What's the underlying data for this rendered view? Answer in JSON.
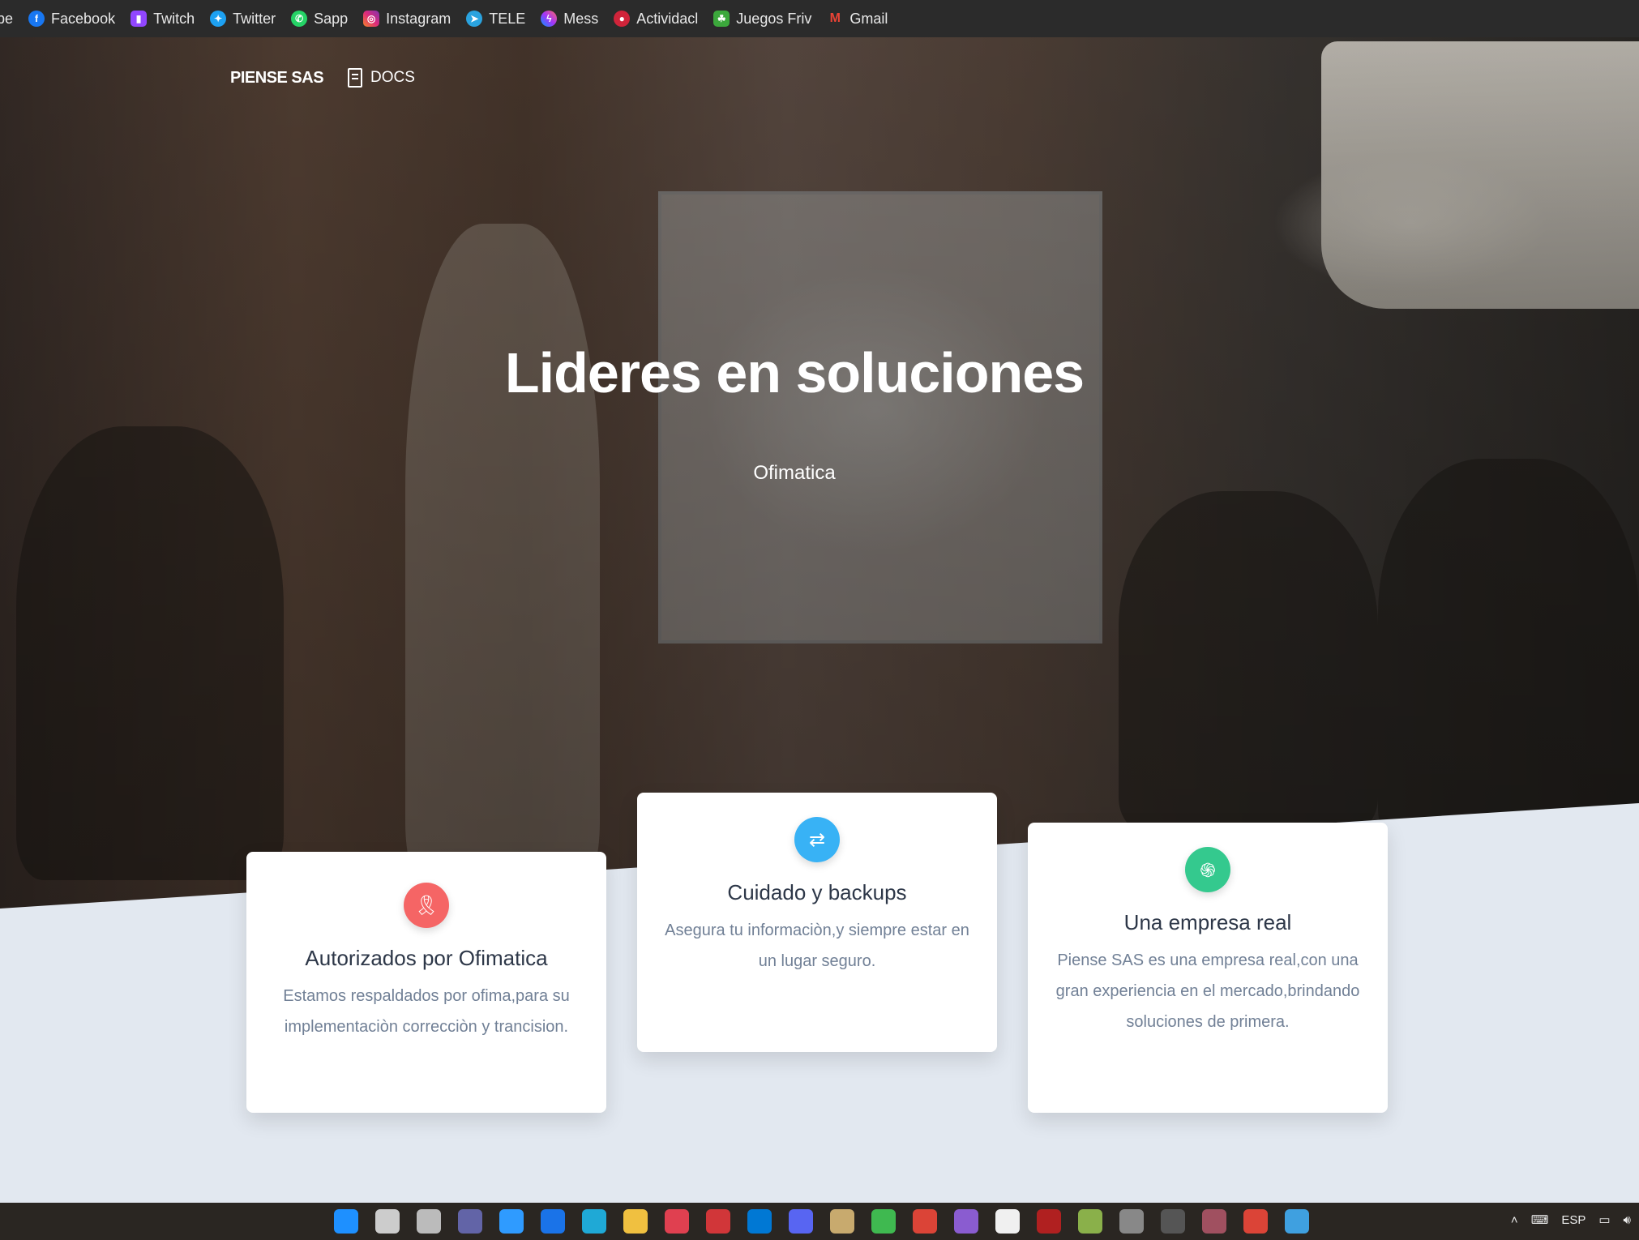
{
  "bookmarks": [
    {
      "label": "be",
      "icon": "youtube-icon",
      "color": "#ff0000"
    },
    {
      "label": "Facebook",
      "icon": "facebook-icon",
      "color": "#1877f2"
    },
    {
      "label": "Twitch",
      "icon": "twitch-icon",
      "color": "#9146ff"
    },
    {
      "label": "Twitter",
      "icon": "twitter-icon",
      "color": "#1da1f2"
    },
    {
      "label": "Sapp",
      "icon": "whatsapp-icon",
      "color": "#25d366"
    },
    {
      "label": "Instagram",
      "icon": "instagram-icon",
      "color": "#e1306c"
    },
    {
      "label": "TELE",
      "icon": "telegram-icon",
      "color": "#2aa3df"
    },
    {
      "label": "Mess",
      "icon": "messenger-icon",
      "color": "#7b5cff"
    },
    {
      "label": "Actividacl",
      "icon": "activity-icon",
      "color": "#d0243a"
    },
    {
      "label": "Juegos Friv",
      "icon": "friv-icon",
      "color": "#3ca83c"
    },
    {
      "label": "Gmail",
      "icon": "gmail-icon",
      "color": "#ea4335"
    }
  ],
  "nav": {
    "brand": "PIENSE SAS",
    "docs_label": "DOCS"
  },
  "hero": {
    "title": "Lideres en soluciones",
    "subtitle": "Ofimatica"
  },
  "cards": [
    {
      "title": "Autorizados por Ofimatica",
      "text": "Estamos respaldados por ofima,para su implementaciòn correcciòn y trancision.",
      "icon": "award-icon",
      "color": "#f56565"
    },
    {
      "title": "Cuidado y backups",
      "text": "Asegura tu informaciòn,y siempre estar en un lugar seguro.",
      "icon": "retweet-icon",
      "color": "#38b2f5"
    },
    {
      "title": "Una empresa real",
      "text": "Piense SAS es una empresa real,con una gran experiencia en el mercado,brindando soluciones de primera.",
      "icon": "fingerprint-icon",
      "color": "#34c98e"
    }
  ],
  "taskbar": {
    "language": "ESP",
    "apps": [
      {
        "icon": "windows-start-icon",
        "color": "#1e90ff"
      },
      {
        "icon": "search-icon",
        "color": "#cccccc"
      },
      {
        "icon": "task-view-icon",
        "color": "#bbbbbb"
      },
      {
        "icon": "teams-icon",
        "color": "#6264a7"
      },
      {
        "icon": "cortana-icon",
        "color": "#2f9bff"
      },
      {
        "icon": "mail-icon",
        "color": "#1a73e8"
      },
      {
        "icon": "edge-icon",
        "color": "#1fa9d6"
      },
      {
        "icon": "file-explorer-icon",
        "color": "#f0c040"
      },
      {
        "icon": "valorant-icon",
        "color": "#e04050"
      },
      {
        "icon": "riot-icon",
        "color": "#d13639"
      },
      {
        "icon": "vscode-icon",
        "color": "#0078d4"
      },
      {
        "icon": "discord-icon",
        "color": "#5865f2"
      },
      {
        "icon": "league-icon",
        "color": "#c8aa6e"
      },
      {
        "icon": "app-icon",
        "color": "#3fb950"
      },
      {
        "icon": "chrome-icon",
        "color": "#db4437"
      },
      {
        "icon": "obs-icon",
        "color": "#8a5cd0"
      },
      {
        "icon": "github-icon",
        "color": "#f0f0f0"
      },
      {
        "icon": "game-icon",
        "color": "#b02020"
      },
      {
        "icon": "notepad-icon",
        "color": "#8ab04a"
      },
      {
        "icon": "settings-icon",
        "color": "#888888"
      },
      {
        "icon": "terminal-icon",
        "color": "#555555"
      },
      {
        "icon": "game2-icon",
        "color": "#a05060"
      },
      {
        "icon": "chrome2-icon",
        "color": "#db4437"
      },
      {
        "icon": "paint-icon",
        "color": "#3fa0e0"
      }
    ]
  }
}
